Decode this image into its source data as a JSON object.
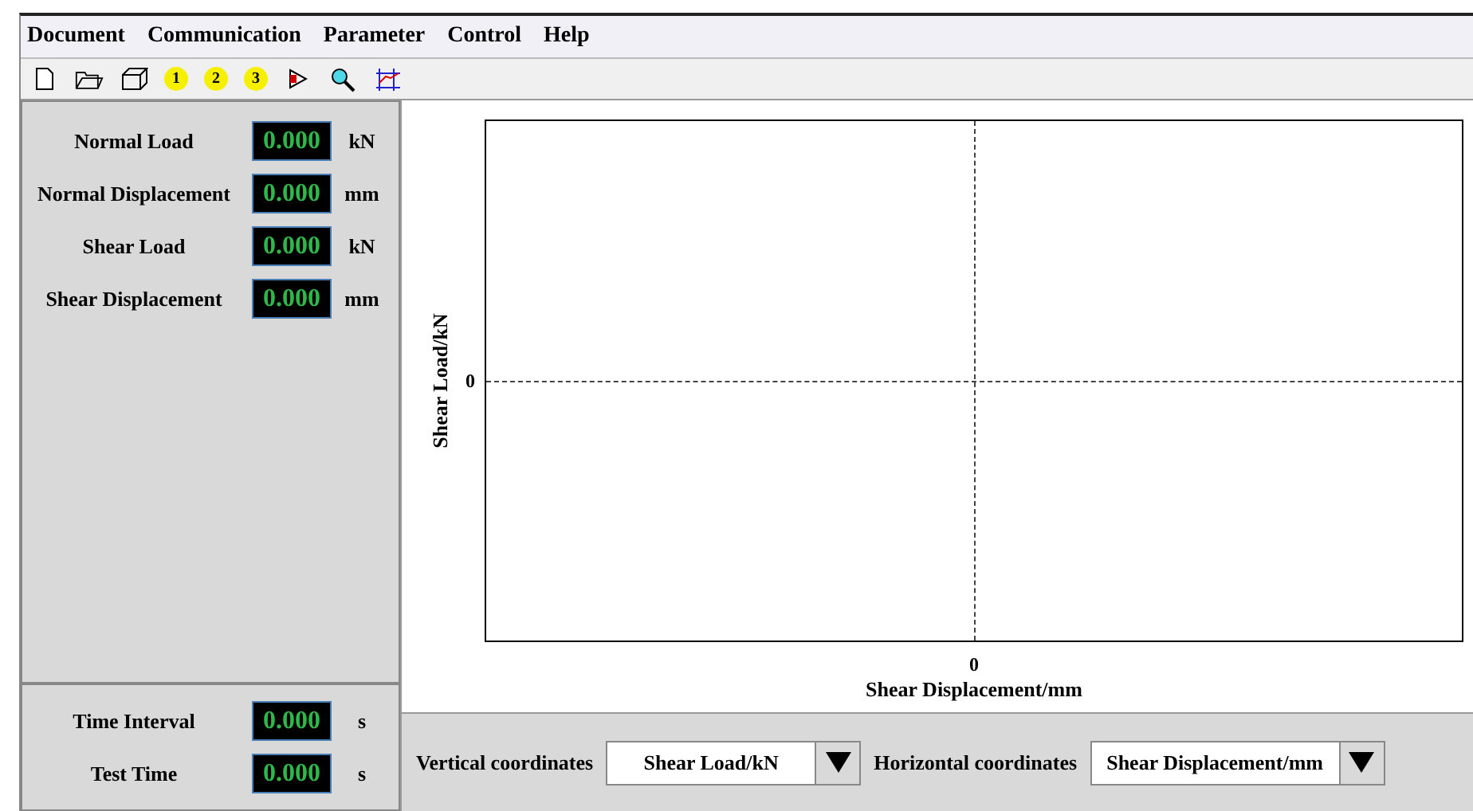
{
  "menu": [
    "Document",
    "Communication",
    "Parameter",
    "Control",
    "Help"
  ],
  "toolbar": [
    {
      "kind": "new"
    },
    {
      "kind": "open"
    },
    {
      "kind": "box"
    },
    {
      "kind": "number",
      "label": "1"
    },
    {
      "kind": "number",
      "label": "2"
    },
    {
      "kind": "number",
      "label": "3"
    },
    {
      "kind": "flag"
    },
    {
      "kind": "search"
    },
    {
      "kind": "axes"
    }
  ],
  "readings": [
    {
      "label": "Normal Load",
      "value": "0.000",
      "unit": "kN"
    },
    {
      "label": "Normal Displacement",
      "value": "0.000",
      "unit": "mm"
    },
    {
      "label": "Shear Load",
      "value": "0.000",
      "unit": "kN"
    },
    {
      "label": "Shear Displacement",
      "value": "0.000",
      "unit": "mm"
    }
  ],
  "timers": [
    {
      "label": "Time Interval",
      "value": "0.000",
      "unit": "s"
    },
    {
      "label": "Test Time",
      "value": "0.000",
      "unit": "s"
    }
  ],
  "plot": {
    "ylabel": "Shear Load/kN",
    "xlabel": "Shear Displacement/mm",
    "ytick": "0",
    "xtick": "0"
  },
  "coordinates": [
    {
      "label": "Vertical coordinates",
      "value": "Shear Load/kN"
    },
    {
      "label": "Horizontal coordinates",
      "value": "Shear Displacement/mm"
    }
  ]
}
